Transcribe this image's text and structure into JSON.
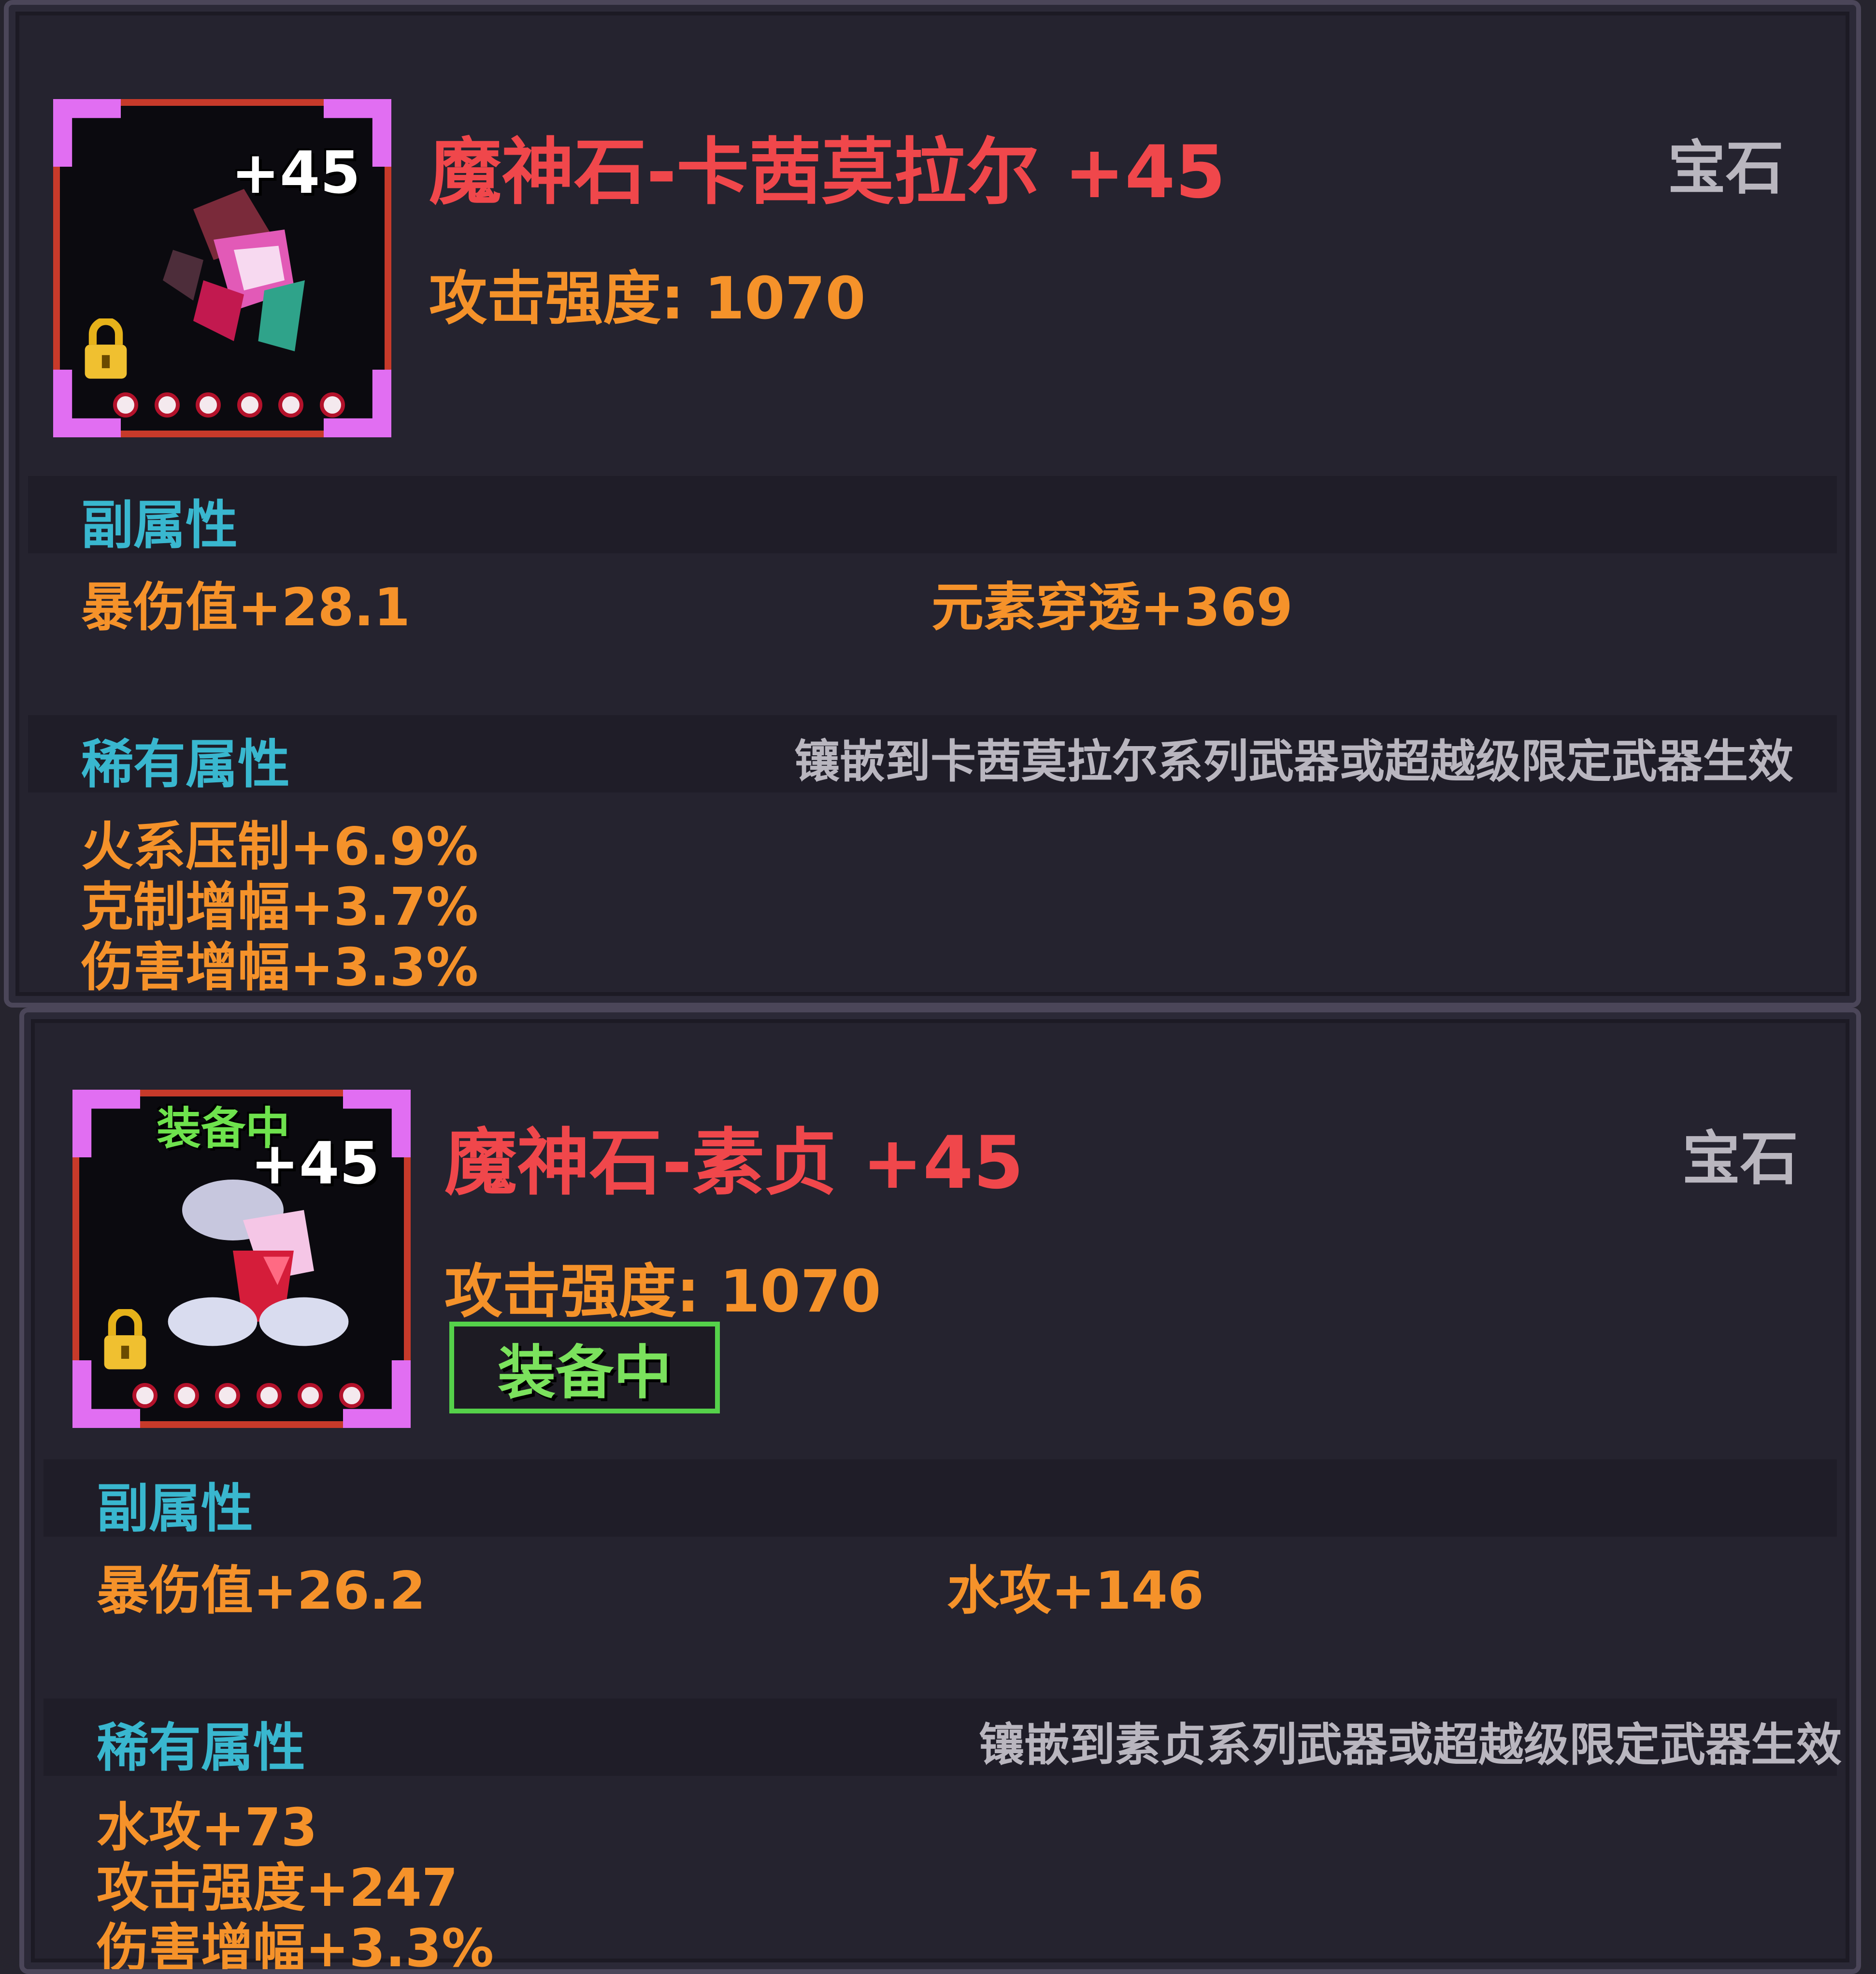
{
  "items": [
    {
      "name": "魔神石-卡茜莫拉尔 +45",
      "category": "宝石",
      "level_badge": "+45",
      "main_stat": "攻击强度: 1070",
      "equipped": false,
      "sub_title": "副属性",
      "sub_attrs": [
        "暴伤值+28.1",
        "元素穿透+369"
      ],
      "rare_title": "稀有属性",
      "rare_note": "镶嵌到卡茜莫拉尔系列武器或超越级限定武器生效",
      "rare_attrs": [
        "火系压制+6.9%",
        "克制增幅+3.7%",
        "伤害增幅+3.3%"
      ]
    },
    {
      "name": "魔神石-素贞 +45",
      "category": "宝石",
      "level_badge": "+45",
      "equipped_small": "装备中",
      "main_stat": "攻击强度: 1070",
      "equipped": true,
      "equip_badge": "装备中",
      "sub_title": "副属性",
      "sub_attrs": [
        "暴伤值+26.2",
        "水攻+146"
      ],
      "rare_title": "稀有属性",
      "rare_note": "镶嵌到素贞系列武器或超越级限定武器生效",
      "rare_attrs": [
        "水攻+73",
        "攻击强度+247",
        "伤害增幅+3.3%"
      ]
    }
  ],
  "colors": {
    "title": "#f0474b",
    "stat": "#f5922a",
    "section": "#39b7cf",
    "note": "#b9b6bf",
    "equip": "#55d14a",
    "frame_corner": "#e16ef2"
  },
  "icons": [
    "gem-icon",
    "lock-icon",
    "star-icon"
  ]
}
